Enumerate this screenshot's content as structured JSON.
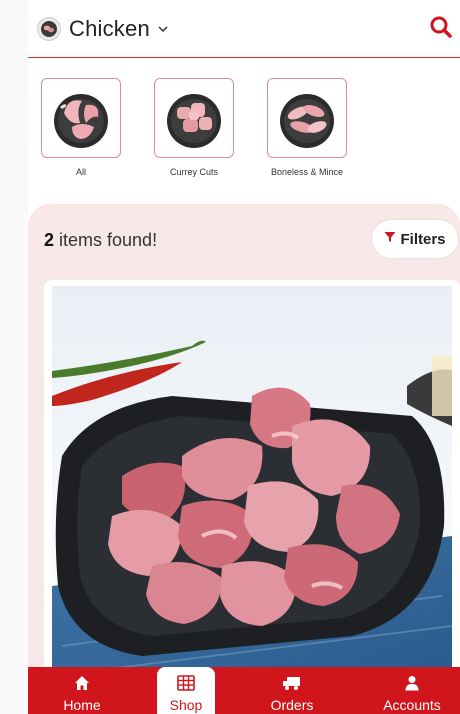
{
  "header": {
    "category_title": "Chicken",
    "icons": {
      "thumb": "chicken-thumb-icon",
      "chevron": "chevron-down-icon",
      "search": "search-icon"
    }
  },
  "categories": [
    {
      "label": "All"
    },
    {
      "label": "Currey Cuts"
    },
    {
      "label": "Boneless & Mince"
    }
  ],
  "products": {
    "count": "2",
    "found_suffix": " items found!",
    "filters_label": "Filters"
  },
  "bottom_nav": [
    {
      "label": "Home",
      "icon": "home-icon"
    },
    {
      "label": "Shop",
      "icon": "shop-grid-icon",
      "active": true
    },
    {
      "label": "Orders",
      "icon": "truck-icon"
    },
    {
      "label": "Accounts",
      "icon": "user-icon"
    }
  ],
  "colors": {
    "accent": "#d0161c",
    "section_bg": "#f9e8e8",
    "header_line": "#d62828"
  }
}
